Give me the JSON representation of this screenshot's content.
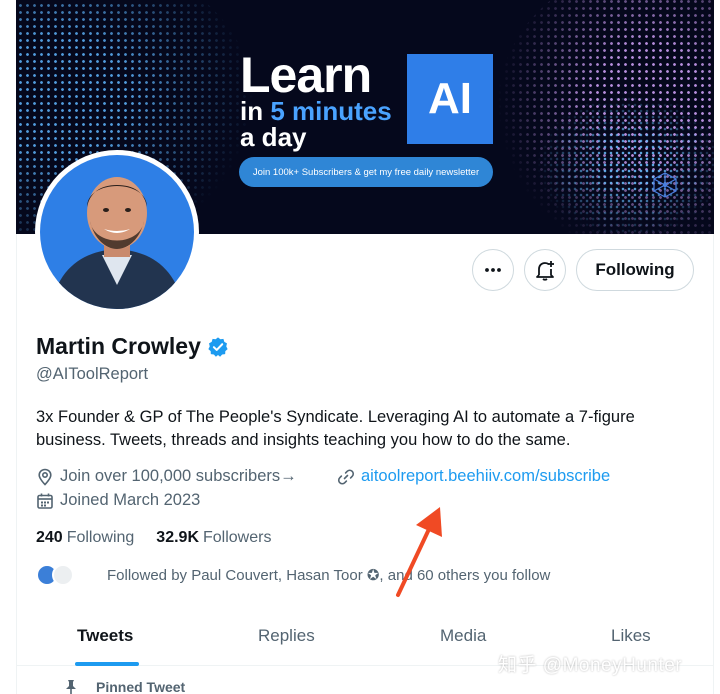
{
  "banner": {
    "headline_learn": "Learn",
    "headline_in": "in",
    "headline_minutes": "5 minutes",
    "headline_aday": "a day",
    "ai_badge": "AI",
    "cta": "Join 100k+ Subscribers & get my free daily newsletter"
  },
  "actions": {
    "more_icon": "more-horizontal-icon",
    "notify_icon": "bell-plus-icon",
    "following_label": "Following"
  },
  "profile": {
    "name": "Martin Crowley",
    "verified_icon": "verified-badge-icon",
    "handle": "@AIToolReport",
    "bio": "3x Founder & GP of The People's Syndicate. Leveraging AI to automate a 7-figure business. Tweets, threads and insights teaching you how to do the same.",
    "location": "Join over 100,000 subscribers→",
    "website": "aitoolreport.beehiiv.com/subscribe",
    "joined": "Joined March 2023"
  },
  "stats": {
    "following_count": "240",
    "following_label": "Following",
    "followers_count": "32.9K",
    "followers_label": "Followers"
  },
  "followed_by": "Followed by Paul Couvert, Hasan Toor ✪, and 60 others you follow",
  "tabs": [
    {
      "label": "Tweets",
      "active": true
    },
    {
      "label": "Replies",
      "active": false
    },
    {
      "label": "Media",
      "active": false
    },
    {
      "label": "Likes",
      "active": false
    }
  ],
  "pinned_label": "Pinned Tweet",
  "watermark": "知乎 @MoneyHunter",
  "colors": {
    "accent": "#1d9bf0",
    "text_primary": "#0f1419",
    "text_secondary": "#536471",
    "banner_bg": "#05081c",
    "arrow": "#f04a24"
  }
}
